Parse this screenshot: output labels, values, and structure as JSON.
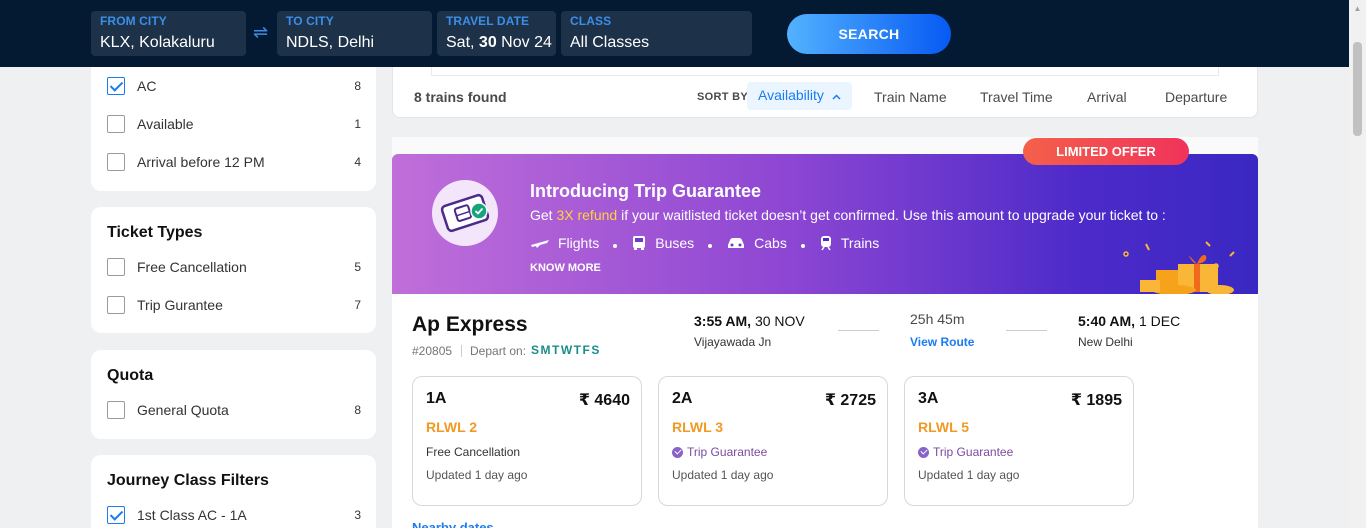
{
  "header": {
    "from": {
      "label": "FROM CITY",
      "value": "KLX, Kolakaluru"
    },
    "to": {
      "label": "TO CITY",
      "value": "NDLS, Delhi"
    },
    "date": {
      "label": "TRAVEL DATE",
      "prefix": "Sat,",
      "day": "30",
      "suffix": "Nov 24"
    },
    "class": {
      "label": "CLASS",
      "value": "All Classes"
    },
    "search_label": "SEARCH",
    "swap_icon": "⇌"
  },
  "filters": {
    "quick": [
      {
        "label": "AC",
        "count": "8",
        "checked": true
      },
      {
        "label": "Available",
        "count": "1",
        "checked": false
      },
      {
        "label": "Arrival before 12 PM",
        "count": "4",
        "checked": false
      }
    ],
    "ticket_types": {
      "title": "Ticket Types",
      "items": [
        {
          "label": "Free Cancellation",
          "count": "5"
        },
        {
          "label": "Trip Gurantee",
          "count": "7"
        }
      ]
    },
    "quota": {
      "title": "Quota",
      "items": [
        {
          "label": "General Quota",
          "count": "8"
        }
      ]
    },
    "journey_class": {
      "title": "Journey Class Filters",
      "items": [
        {
          "label": "1st Class AC - 1A",
          "count": "3",
          "checked": true
        }
      ]
    }
  },
  "results": {
    "found": "8 trains found",
    "sort_by": "SORT BY",
    "sort_options": [
      "Availability",
      "Train Name",
      "Travel Time",
      "Arrival",
      "Departure"
    ],
    "active_sort": "Availability"
  },
  "offer": {
    "badge": "LIMITED OFFER",
    "title": "Introducing Trip Guarantee",
    "desc_pre": "Get ",
    "desc_hl": "3X refund",
    "desc_post": " if your waitlisted ticket doesn’t get confirmed. Use this amount to upgrade your ticket to :",
    "modes": [
      "Flights",
      "Buses",
      "Cabs",
      "Trains"
    ],
    "know_more": "KNOW MORE",
    "accent": "#ffd33d"
  },
  "train": {
    "name": "Ap Express",
    "number": "#20805",
    "depart_on_label": "Depart on:",
    "days": "SMTWTFS",
    "dep_time": "3:55 AM,",
    "dep_date": "30 NOV",
    "dep_station": "Vijayawada Jn",
    "duration": "25h 45m",
    "view_route": "View Route",
    "arr_time": "5:40 AM,",
    "arr_date": "1 DEC",
    "arr_station": "New Delhi",
    "classes": [
      {
        "name": "1A",
        "price": "₹ 4640",
        "status": "RLWL 2",
        "feature": "Free Cancellation",
        "updated": "Updated 1 day ago"
      },
      {
        "name": "2A",
        "price": "₹ 2725",
        "status": "RLWL 3",
        "feature": "Trip Guarantee",
        "updated": "Updated 1 day ago"
      },
      {
        "name": "3A",
        "price": "₹ 1895",
        "status": "RLWL 5",
        "feature": "Trip Guarantee",
        "updated": "Updated 1 day ago"
      }
    ],
    "nudge": "Nearby dates"
  }
}
